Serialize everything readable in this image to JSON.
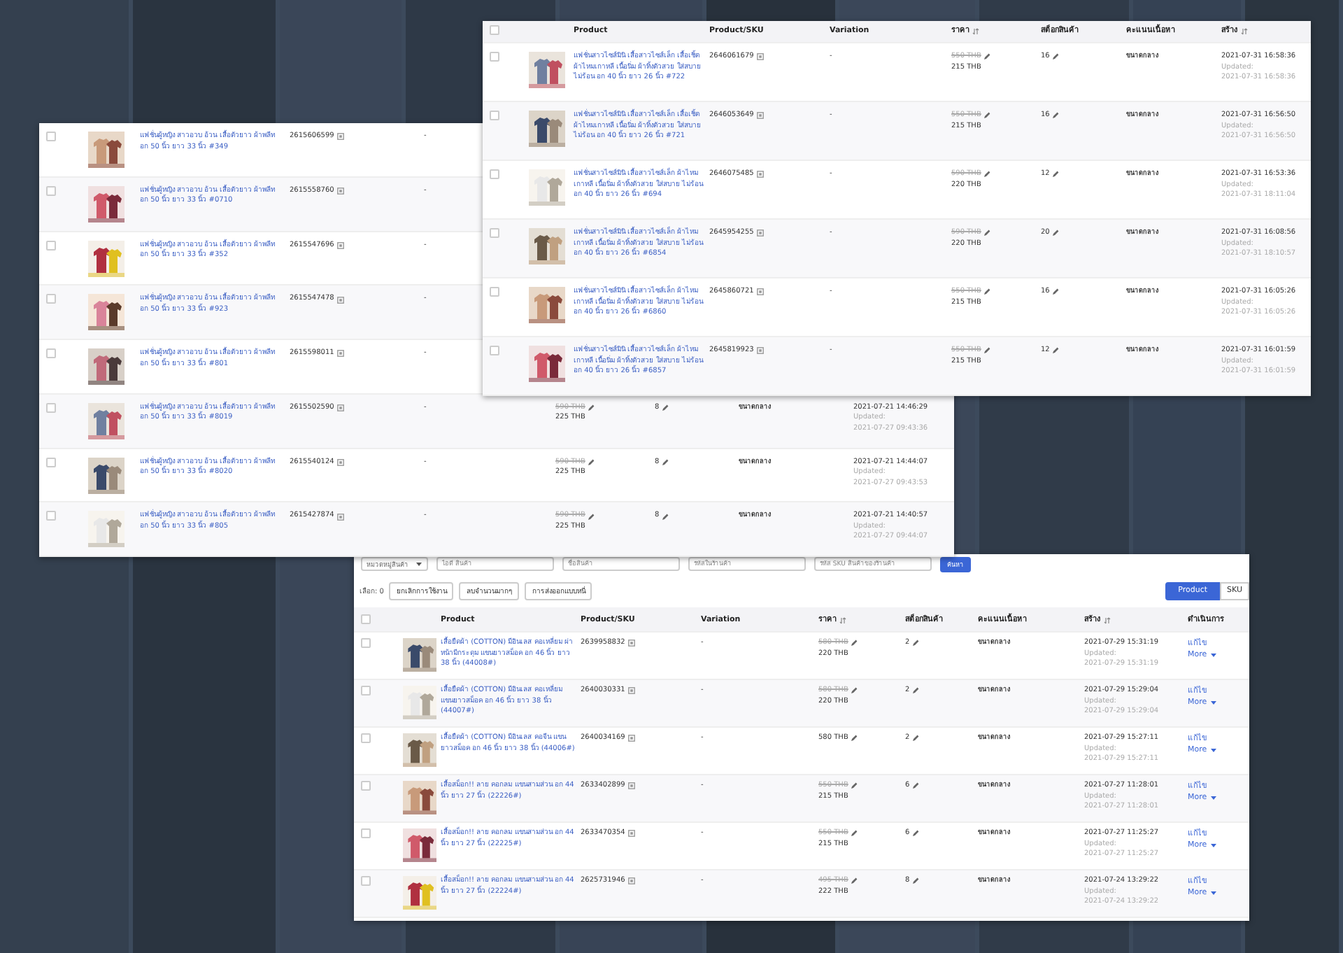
{
  "back_table": {
    "rows": [
      {
        "checked": false,
        "product": "แฟชั่นผู้หญิง สาวอวบ อ้วน เสื้อตัวยาว ผ้าพลีท อก 50 นิ้ว ยาว 33 นิ้ว #349",
        "sku": "2615606599",
        "variation": "-"
      },
      {
        "checked": false,
        "product": "แฟชั่นผู้หญิง สาวอวบ อ้วน เสื้อตัวยาว ผ้าพลีท อก 50 นิ้ว ยาว 33 นิ้ว #0710",
        "sku": "2615558760",
        "variation": "-"
      },
      {
        "checked": false,
        "product": "แฟชั่นผู้หญิง สาวอวบ อ้วน เสื้อตัวยาว ผ้าพลีท อก 50 นิ้ว ยาว 33 นิ้ว #352",
        "sku": "2615547696",
        "variation": "-"
      },
      {
        "checked": false,
        "product": "แฟชั่นผู้หญิง สาวอวบ อ้วน เสื้อตัวยาว ผ้าพลีท อก 50 นิ้ว ยาว 33 นิ้ว #923",
        "sku": "2615547478",
        "variation": "-"
      },
      {
        "checked": false,
        "product": "แฟชั่นผู้หญิง สาวอวบ อ้วน เสื้อตัวยาว ผ้าพลีท อก 50 นิ้ว ยาว 33 นิ้ว #801",
        "sku": "2615598011",
        "variation": "-"
      },
      {
        "checked": false,
        "product": "แฟชั่นผู้หญิง สาวอวบ อ้วน เสื้อตัวยาว ผ้าพลีท อก 50 นิ้ว ยาว 33 นิ้ว #8019",
        "sku": "2615502590",
        "variation": "-",
        "price_original": "590 THB",
        "price": "225 THB",
        "stock": "8",
        "content_score": "ขนาดกลาง",
        "created": "2021-07-21 14:46:29",
        "updated_label": "Updated:",
        "updated": "2021-07-27 09:43:36"
      },
      {
        "checked": false,
        "product": "แฟชั่นผู้หญิง สาวอวบ อ้วน เสื้อตัวยาว ผ้าพลีท อก 50 นิ้ว ยาว 33 นิ้ว #8020",
        "sku": "2615540124",
        "variation": "-",
        "price_original": "590 THB",
        "price": "225 THB",
        "stock": "8",
        "content_score": "ขนาดกลาง",
        "created": "2021-07-21 14:44:07",
        "updated_label": "Updated:",
        "updated": "2021-07-27 09:43:53"
      },
      {
        "checked": false,
        "product": "แฟชั่นผู้หญิง สาวอวบ อ้วน เสื้อตัวยาว ผ้าพลีท อก 50 นิ้ว ยาว 33 นิ้ว #805",
        "sku": "2615427874",
        "variation": "-",
        "price_original": "590 THB",
        "price": "225 THB",
        "stock": "8",
        "content_score": "ขนาดกลาง",
        "created": "2021-07-21 14:40:57",
        "updated_label": "Updated:",
        "updated": "2021-07-27 09:44:07"
      }
    ]
  },
  "front_table": {
    "header_checked": false,
    "columns": [
      {
        "label": "Product",
        "sortable": false
      },
      {
        "label": "Product/SKU",
        "sortable": false
      },
      {
        "label": "Variation",
        "sortable": false
      },
      {
        "label": "ราคา",
        "sortable": true
      },
      {
        "label": "สต็อกสินค้า",
        "sortable": false
      },
      {
        "label": "คะแนนเนื้อหา",
        "sortable": false
      },
      {
        "label": "สร้าง",
        "sortable": true
      }
    ],
    "rows": [
      {
        "checked": false,
        "product": "แฟชั่นสาวไซส์มินิ เสื้อสาวไซส์เล็ก เสื้อเชิ้ตผ้าไหมเกาหลี เนื้อนิ่ม ผ้าทิ้งตัวสวย ใส่สบาย ไม่ร้อน อก 40 นิ้ว ยาว 26 นิ้ว #722",
        "sku": "2646061679",
        "variation": "-",
        "price_original": "550 THB",
        "price": "215 THB",
        "stock": "16",
        "content_score": "ขนาดกลาง",
        "created": "2021-07-31 16:58:36",
        "updated_label": "Updated:",
        "updated": "2021-07-31 16:58:36"
      },
      {
        "checked": false,
        "product": "แฟชั่นสาวไซส์มินิ เสื้อสาวไซส์เล็ก เสื้อเชิ้ตผ้าไหมเกาหลี เนื้อนิ่ม ผ้าทิ้งตัวสวย ใส่สบาย ไม่ร้อน อก 40 นิ้ว ยาว 26 นิ้ว #721",
        "sku": "2646053649",
        "variation": "-",
        "price_original": "550 THB",
        "price": "215 THB",
        "stock": "16",
        "content_score": "ขนาดกลาง",
        "created": "2021-07-31 16:56:50",
        "updated_label": "Updated:",
        "updated": "2021-07-31 16:56:50"
      },
      {
        "checked": false,
        "product": "แฟชั่นสาวไซส์มินิ เสื้อสาวไซส์เล็ก ผ้าไหมเกาหลี เนื้อนิ่ม ผ้าทิ้งตัวสวย ใส่สบาย ไม่ร้อน อก 40 นิ้ว ยาว 26 นิ้ว #694",
        "sku": "2646075485",
        "variation": "-",
        "price_original": "590 THB",
        "price": "220 THB",
        "stock": "12",
        "content_score": "ขนาดกลาง",
        "created": "2021-07-31 16:53:36",
        "updated_label": "Updated:",
        "updated": "2021-07-31 18:11:04"
      },
      {
        "checked": false,
        "product": "แฟชั่นสาวไซส์มินิ เสื้อสาวไซส์เล็ก ผ้าไหมเกาหลี เนื้อนิ่ม ผ้าทิ้งตัวสวย ใส่สบาย ไม่ร้อน อก 40 นิ้ว ยาว 26 นิ้ว #6854",
        "sku": "2645954255",
        "variation": "-",
        "price_original": "590 THB",
        "price": "220 THB",
        "stock": "20",
        "content_score": "ขนาดกลาง",
        "created": "2021-07-31 16:08:56",
        "updated_label": "Updated:",
        "updated": "2021-07-31 18:10:57"
      },
      {
        "checked": false,
        "product": "แฟชั่นสาวไซส์มินิ เสื้อสาวไซส์เล็ก ผ้าไหมเกาหลี เนื้อนิ่ม ผ้าทิ้งตัวสวย ใส่สบาย ไม่ร้อน อก 40 นิ้ว ยาว 26 นิ้ว #6860",
        "sku": "2645860721",
        "variation": "-",
        "price_original": "550 THB",
        "price": "215 THB",
        "stock": "16",
        "content_score": "ขนาดกลาง",
        "created": "2021-07-31 16:05:26",
        "updated_label": "Updated:",
        "updated": "2021-07-31 16:05:26"
      },
      {
        "checked": false,
        "product": "แฟชั่นสาวไซส์มินิ เสื้อสาวไซส์เล็ก ผ้าไหมเกาหลี เนื้อนิ่ม ผ้าทิ้งตัวสวย ใส่สบาย ไม่ร้อน อก 40 นิ้ว ยาว 26 นิ้ว #6857",
        "sku": "2645819923",
        "variation": "-",
        "price_original": "550 THB",
        "price": "215 THB",
        "stock": "12",
        "content_score": "ขนาดกลาง",
        "created": "2021-07-31 16:01:59",
        "updated_label": "Updated:",
        "updated": "2021-07-31 16:01:59"
      }
    ]
  },
  "bottom_panel": {
    "filters": [
      {
        "kind": "select",
        "placeholder": "หมวดหมู่สินค้า"
      },
      {
        "kind": "text",
        "placeholder": "ไอดี สินค้า"
      },
      {
        "kind": "text",
        "placeholder": "ชื่อสินค้า"
      },
      {
        "kind": "text",
        "placeholder": "รหัสในร้านค้า"
      },
      {
        "kind": "text",
        "placeholder": "รหัส SKU สินค้าของร้านค้า"
      }
    ],
    "search_button": "ค้นหา",
    "selected_count": "เลือก: 0",
    "bulk_buttons": [
      "ยกเลิกการใช้งาน",
      "ลบจำนวนมากๆ",
      "การส่งออกแบบหนี่"
    ],
    "view_toggle": [
      {
        "label": "Product",
        "selected": true
      },
      {
        "label": "SKU",
        "selected": false
      }
    ],
    "table": {
      "header_checked": false,
      "columns": [
        {
          "label": "Product",
          "sortable": false
        },
        {
          "label": "Product/SKU",
          "sortable": false
        },
        {
          "label": "Variation",
          "sortable": false
        },
        {
          "label": "ราคา",
          "sortable": true
        },
        {
          "label": "สต็อกสินค้า",
          "sortable": false
        },
        {
          "label": "คะแนนเนื้อหา",
          "sortable": false
        },
        {
          "label": "สร้าง",
          "sortable": true
        },
        {
          "label": "ดำเนินการ",
          "sortable": false
        }
      ],
      "rows": [
        {
          "checked": false,
          "product": "เสื้อยืดผ้า (COTTON) มีอินเลส คอเหลี่ยม ผ่าหน้ามีกระดุม แขนยาวสม็อค อก 46 นิ้ว ยาว 38 นิ้ว (44008#)",
          "sku": "2639958832",
          "variation": "-",
          "price_original": "580 THB",
          "price": "220 THB",
          "stock": "2",
          "content_score": "ขนาดกลาง",
          "created": "2021-07-29 15:31:19",
          "updated_label": "Updated:",
          "updated": "2021-07-29 15:31:19",
          "edit": "แก้ไข",
          "more": "More"
        },
        {
          "checked": false,
          "product": "เสื้อยืดผ้า (COTTON) มีอินเลส คอเหลี่ยม แขนยาวสม็อค อก 46 นิ้ว ยาว 38 นิ้ว (44007#)",
          "sku": "2640030331",
          "variation": "-",
          "price_original": "580 THB",
          "price": "220 THB",
          "stock": "2",
          "content_score": "ขนาดกลาง",
          "created": "2021-07-29 15:29:04",
          "updated_label": "Updated:",
          "updated": "2021-07-29 15:29:04",
          "edit": "แก้ไข",
          "more": "More"
        },
        {
          "checked": false,
          "product": "เสื้อยืดผ้า (COTTON) มีอินเลส คอจีน แขนยาวสม็อค อก 46 นิ้ว ยาว 38 นิ้ว (44006#)",
          "sku": "2640034169",
          "variation": "-",
          "price": "580 THB",
          "stock": "2",
          "content_score": "ขนาดกลาง",
          "created": "2021-07-29 15:27:11",
          "updated_label": "Updated:",
          "updated": "2021-07-29 15:27:11",
          "edit": "แก้ไข",
          "more": "More"
        },
        {
          "checked": false,
          "product": "เสื้อสม็อก!! ลาย คอกลม แขนสามส่วน อก 44 นิ้ว ยาว 27 นิ้ว (22226#)",
          "sku": "2633402899",
          "variation": "-",
          "price_original": "550 THB",
          "price": "215 THB",
          "stock": "6",
          "content_score": "ขนาดกลาง",
          "created": "2021-07-27 11:28:01",
          "updated_label": "Updated:",
          "updated": "2021-07-27 11:28:01",
          "edit": "แก้ไข",
          "more": "More"
        },
        {
          "checked": false,
          "product": "เสื้อสม็อก!! ลาย คอกลม แขนสามส่วน อก 44 นิ้ว ยาว 27 นิ้ว (22225#)",
          "sku": "2633470354",
          "variation": "-",
          "price_original": "550 THB",
          "price": "215 THB",
          "stock": "6",
          "content_score": "ขนาดกลาง",
          "created": "2021-07-27 11:25:27",
          "updated_label": "Updated:",
          "updated": "2021-07-27 11:25:27",
          "edit": "แก้ไข",
          "more": "More"
        },
        {
          "checked": false,
          "product": "เสื้อสม็อก!! ลาย คอกลม แขนสามส่วน อก 44 นิ้ว ยาว 27 นิ้ว (22224#)",
          "sku": "2625731946",
          "variation": "-",
          "price_original": "495 THB",
          "price": "222 THB",
          "stock": "8",
          "content_score": "ขนาดกลาง",
          "created": "2021-07-24 13:29:22",
          "updated_label": "Updated:",
          "updated": "2021-07-24 13:29:22",
          "edit": "แก้ไข",
          "more": "More"
        }
      ]
    }
  }
}
